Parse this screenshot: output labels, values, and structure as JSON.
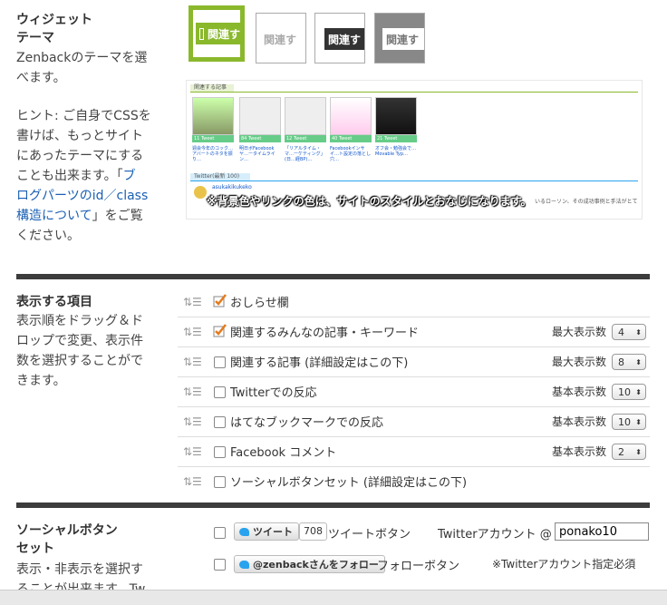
{
  "theme_section": {
    "title_line1": "ウィジェット",
    "title_line2": "テーマ",
    "desc": [
      "Zenbackのテーマを選",
      "べます。"
    ],
    "hint": [
      "ヒント: ご自身でCSSを",
      "書けば、もっとサイト",
      "にあったテーマにする",
      "ことも出来ます。「"
    ],
    "hint_link": [
      "ブ",
      "ログパーツのid／class",
      "構造について"
    ],
    "hint_tail": [
      "」をご覧",
      "ください。"
    ],
    "themes": [
      {
        "label": "関連す",
        "selected": true,
        "bar_color": "#8ab82c",
        "text_color": "#ffffff"
      },
      {
        "label": "関連す",
        "selected": false,
        "bar_color": "#ffffff",
        "text_color": "#aaaaaa"
      },
      {
        "label": "関連す",
        "selected": false,
        "bar_color": "#333333",
        "text_color": "#ffffff"
      },
      {
        "label": "関連す",
        "selected": false,
        "bar_color": "#888888",
        "text_color": "#ffffff"
      }
    ],
    "preview": {
      "related_header": "関連する記事",
      "twitter_header": "Twitter(最新 100)",
      "items": [
        {
          "caption": "11 Tweet",
          "text": "週会今年のコック…アバートのネタを振り…"
        },
        {
          "caption": "84 Tweet",
          "text": "明日ボFacebookヤ…ータイムライン…"
        },
        {
          "caption": "12 Tweet",
          "text": "「リアルタイム・マ…ーケティング」(日…経BP)…"
        },
        {
          "caption": "40 Tweet",
          "text": "Facebookインサイ…ト設定の落とし穴…"
        },
        {
          "caption": "21 Tweet",
          "text": "オフ会・勉強会で…Movable Typ…"
        }
      ],
      "tw_user": "asukakikukeko",
      "tw_text": "いるローソン、その成功事例と手法がとて",
      "note": "※背景色やリンクの色は、サイトのスタイルとおなじになります。"
    }
  },
  "items_section": {
    "title": "表示する項目",
    "desc": [
      "表示順をドラッグ＆ド",
      "ロップで変更、表示件",
      "数を選択することがで",
      "きます。"
    ],
    "rows": [
      {
        "label": "おしらせ欄",
        "checked": true,
        "meta": "",
        "value": ""
      },
      {
        "label": "関連するみんなの記事・キーワード",
        "checked": true,
        "meta": "最大表示数",
        "value": "4"
      },
      {
        "label": "関連する記事 (詳細設定はこの下)",
        "checked": false,
        "meta": "最大表示数",
        "value": "8"
      },
      {
        "label": "Twitterでの反応",
        "checked": false,
        "meta": "基本表示数",
        "value": "10"
      },
      {
        "label": "はてなブックマークでの反応",
        "checked": false,
        "meta": "基本表示数",
        "value": "10"
      },
      {
        "label": "Facebook コメント",
        "checked": false,
        "meta": "基本表示数",
        "value": "2"
      },
      {
        "label": "ソーシャルボタンセット (詳細設定はこの下)",
        "checked": false,
        "meta": "",
        "value": ""
      }
    ]
  },
  "social_section": {
    "title_line1": "ソーシャルボタン",
    "title_line2": "セット",
    "desc": [
      "表示・非表示を選択す",
      "ることが出来ます。Tw"
    ],
    "tweet_button": "ツイート",
    "tweet_count": "708",
    "tweet_label": "ツイートボタン",
    "account_label": "Twitterアカウント @",
    "account_value": "ponako10",
    "follow_button": "@zenbackさんをフォロー",
    "follow_label": "フォローボタン",
    "follow_note": "※Twitterアカウント指定必須"
  },
  "colors": {
    "accent": "#8ab82c",
    "separator": "#3c3c3c",
    "link": "#1a5fb4",
    "twitter": "#2aa3ef",
    "check": "#e57b1e"
  }
}
